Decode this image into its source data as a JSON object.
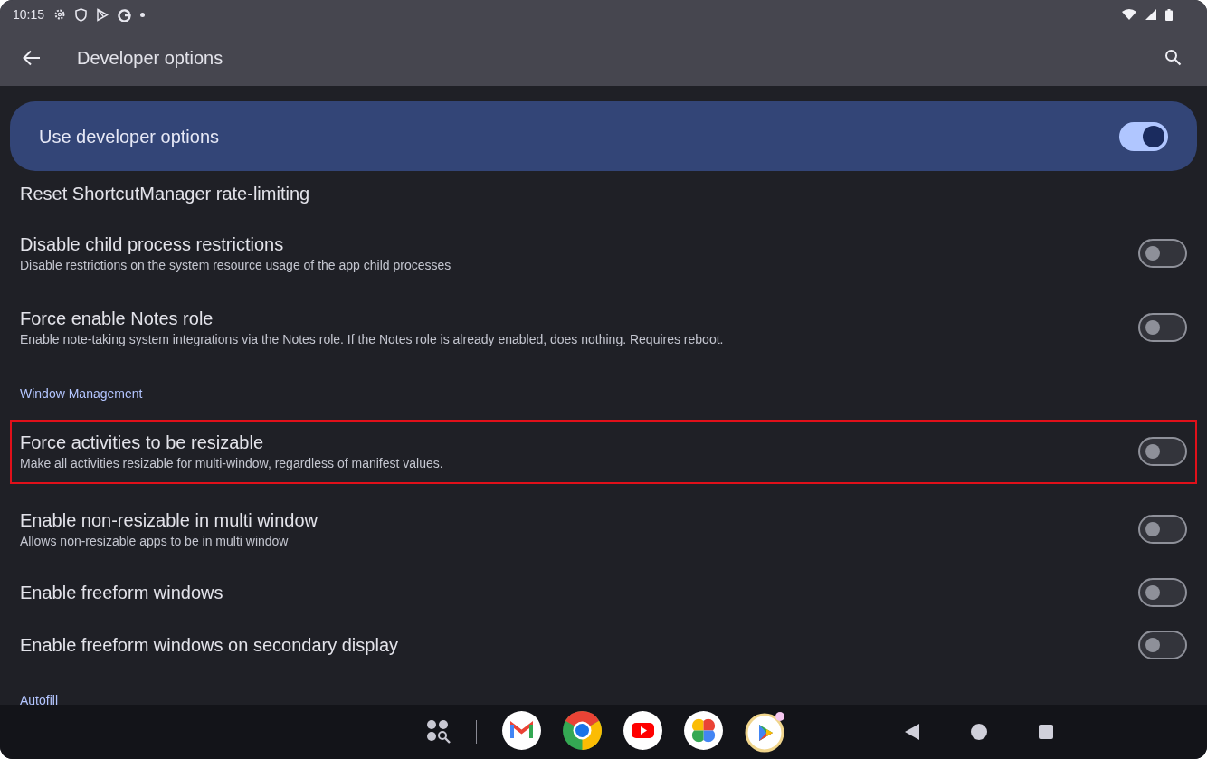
{
  "status_bar": {
    "time": "10:15"
  },
  "app_bar": {
    "title": "Developer options"
  },
  "main_switch": {
    "label": "Use developer options",
    "on": true
  },
  "items": [
    {
      "kind": "action",
      "title": "Reset ShortcutManager rate-limiting"
    },
    {
      "kind": "toggle",
      "title": "Disable child process restrictions",
      "summary": "Disable restrictions on the system resource usage of the app child processes",
      "on": false,
      "highlighted": false
    },
    {
      "kind": "toggle",
      "title": "Force enable Notes role",
      "summary": "Enable note-taking system integrations via the Notes role. If the Notes role is already enabled, does nothing. Requires reboot.",
      "on": false,
      "highlighted": false
    },
    {
      "kind": "header",
      "title": "Window Management"
    },
    {
      "kind": "toggle",
      "title": "Force activities to be resizable",
      "summary": "Make all activities resizable for multi-window, regardless of manifest values.",
      "on": false,
      "highlighted": true
    },
    {
      "kind": "toggle",
      "title": "Enable non-resizable in multi window",
      "summary": "Allows non-resizable apps to be in multi window",
      "on": false,
      "highlighted": false
    },
    {
      "kind": "toggle",
      "title": "Enable freeform windows",
      "on": false,
      "highlighted": false
    },
    {
      "kind": "toggle",
      "title": "Enable freeform windows on secondary display",
      "on": false,
      "highlighted": false
    },
    {
      "kind": "header",
      "title": "Autofill"
    }
  ]
}
